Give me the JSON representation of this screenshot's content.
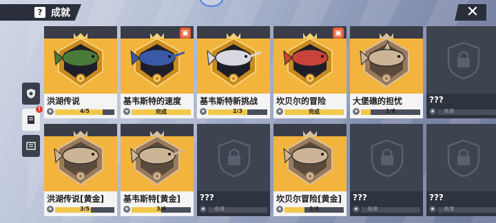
{
  "header": {
    "help_icon_text": "?",
    "title": "成就",
    "close_label": "✕"
  },
  "sidebar": {
    "tabs": [
      {
        "name": "shield-tab"
      },
      {
        "name": "book-tab",
        "badge": "!"
      },
      {
        "name": "list-tab"
      }
    ]
  },
  "cards": [
    {
      "name": "洪湖传说",
      "progress": "4/5",
      "ratio": 0.8,
      "state": "gold",
      "gift": false,
      "fish": "bass"
    },
    {
      "name": "基韦斯特的速度",
      "progress": "完成",
      "ratio": 1,
      "state": "gold",
      "gift": true,
      "fish": "marlin"
    },
    {
      "name": "基韦斯特新挑战",
      "progress": "2/3",
      "ratio": 0.667,
      "state": "gold",
      "gift": false,
      "fish": "swordfish"
    },
    {
      "name": "坎贝尔的冒险",
      "progress": "完成",
      "ratio": 1,
      "state": "gold",
      "gift": true,
      "fish": "grouper"
    },
    {
      "name": "大堡礁的担忧",
      "progress": "1/6",
      "ratio": 0.167,
      "state": "gold-bronze",
      "gift": false,
      "fish": "shark"
    },
    {
      "name": "???",
      "progress": "0/8",
      "ratio": 0,
      "state": "locked",
      "gift": false
    },
    {
      "name": "洪湖传说[黄金]",
      "progress": "3/5",
      "ratio": 0.6,
      "state": "gold-bronze",
      "gift": false,
      "fish": "bass"
    },
    {
      "name": "基韦斯特[黄金]",
      "progress": "3/6",
      "ratio": 0.5,
      "state": "gold-bronze",
      "gift": false,
      "fish": "marlin"
    },
    {
      "name": "???",
      "progress": "0/8",
      "ratio": 0,
      "state": "locked",
      "gift": false
    },
    {
      "name": "坎贝尔冒险[黄金]",
      "progress": "2/6",
      "ratio": 0.333,
      "state": "gold-bronze",
      "gift": false,
      "fish": "grouper"
    },
    {
      "name": "???",
      "progress": "0/8",
      "ratio": 0,
      "state": "locked",
      "gift": false
    },
    {
      "name": "???",
      "progress": "0/8",
      "ratio": 0,
      "state": "locked",
      "gift": false
    }
  ],
  "colors": {
    "gold": "#f2b43c",
    "dark_panel": "#2e3340",
    "accent_red": "#e23a2d"
  }
}
